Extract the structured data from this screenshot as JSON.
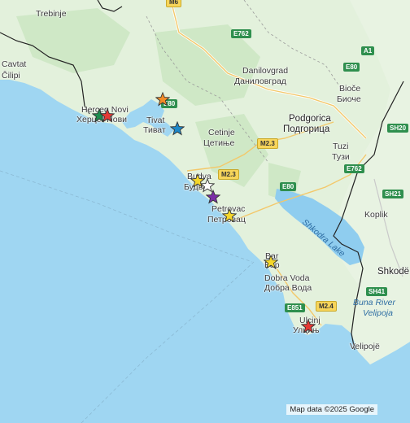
{
  "map": {
    "attribution": "Map data ©2025 Google",
    "colors": {
      "sea": "#9fd6f2",
      "land": "#dff0db",
      "forest": "#c8e6c0",
      "lake": "#8fcdef",
      "border": "#222222"
    }
  },
  "places": [
    {
      "id": "trebinje",
      "name": "Trebinje"
    },
    {
      "id": "cavtat",
      "name": "Cavtat"
    },
    {
      "id": "cilipi",
      "name": "Čilipi"
    },
    {
      "id": "herceg-lat",
      "name": "Herceg Novi"
    },
    {
      "id": "herceg-cyr",
      "name": "Херцег Нови"
    },
    {
      "id": "tivat-lat",
      "name": "Tivat"
    },
    {
      "id": "tivat-cyr",
      "name": "Тиват"
    },
    {
      "id": "danilovgrad-lat",
      "name": "Danilovgrad"
    },
    {
      "id": "danilovgrad-cyr",
      "name": "Даниловград"
    },
    {
      "id": "biocje-lat",
      "name": "Bioče"
    },
    {
      "id": "biocje-cyr",
      "name": "Биоче"
    },
    {
      "id": "podgorica-lat",
      "name": "Podgorica"
    },
    {
      "id": "podgorica-cyr",
      "name": "Подгорица"
    },
    {
      "id": "cetinje-lat",
      "name": "Cetinje"
    },
    {
      "id": "cetinje-cyr",
      "name": "Цетиње"
    },
    {
      "id": "tuzi-lat",
      "name": "Tuzi"
    },
    {
      "id": "tuzi-cyr",
      "name": "Тузи"
    },
    {
      "id": "budva-lat",
      "name": "Budva"
    },
    {
      "id": "budva-cyr",
      "name": "Будва"
    },
    {
      "id": "petrovac-lat",
      "name": "Petrovac"
    },
    {
      "id": "petrovac-cyr",
      "name": "Петровац"
    },
    {
      "id": "koplik",
      "name": "Koplik"
    },
    {
      "id": "bar-lat",
      "name": "Bar"
    },
    {
      "id": "bar-cyr",
      "name": "Бар"
    },
    {
      "id": "dobra-lat",
      "name": "Dobra Voda"
    },
    {
      "id": "dobra-cyr",
      "name": "Добра Вода"
    },
    {
      "id": "shkoder",
      "name": "Shkodë"
    },
    {
      "id": "ulcinj-lat",
      "name": "Ulcinj"
    },
    {
      "id": "ulcinj-cyr",
      "name": "Улцињ"
    },
    {
      "id": "velipoje",
      "name": "Velipojë"
    }
  ],
  "water_labels": [
    {
      "id": "skadar",
      "name": "Shkodra Lake"
    },
    {
      "id": "buna",
      "name": "Buna River"
    },
    {
      "id": "velipoja",
      "name": "Velipoja"
    }
  ],
  "road_shields": [
    {
      "id": "m6",
      "label": "M6",
      "style": "yellow"
    },
    {
      "id": "e762-n",
      "label": "E762",
      "style": "green"
    },
    {
      "id": "a1",
      "label": "A1",
      "style": "green"
    },
    {
      "id": "e80-n",
      "label": "E80",
      "style": "green"
    },
    {
      "id": "e80-w",
      "label": "E80",
      "style": "green"
    },
    {
      "id": "m23-a",
      "label": "M2.3",
      "style": "yellow"
    },
    {
      "id": "m23-b",
      "label": "M2.3",
      "style": "yellow"
    },
    {
      "id": "sh20",
      "label": "SH20",
      "style": "green"
    },
    {
      "id": "e762-s",
      "label": "E762",
      "style": "green"
    },
    {
      "id": "e80-s",
      "label": "E80",
      "style": "green"
    },
    {
      "id": "sh21",
      "label": "SH21",
      "style": "green"
    },
    {
      "id": "sh41",
      "label": "SH41",
      "style": "green"
    },
    {
      "id": "e851",
      "label": "E851",
      "style": "green"
    },
    {
      "id": "m24",
      "label": "M2.4",
      "style": "yellow"
    }
  ],
  "markers": [
    {
      "id": "kotor",
      "icon": "star-icon",
      "color": "#f28c28"
    },
    {
      "id": "herceg-green",
      "icon": "star-icon",
      "color": "#1e8c4e"
    },
    {
      "id": "herceg-red",
      "icon": "star-icon",
      "color": "#e53935"
    },
    {
      "id": "tivat-blue",
      "icon": "star-icon",
      "color": "#1e88c8"
    },
    {
      "id": "budva-yellow",
      "icon": "star-icon",
      "color": "#f5d72b"
    },
    {
      "id": "budva-white",
      "icon": "star-icon",
      "color": "#ffffff"
    },
    {
      "id": "budva-purple",
      "icon": "star-icon",
      "color": "#7b2fa6"
    },
    {
      "id": "petrovac-yellow",
      "icon": "star-icon",
      "color": "#f5d72b"
    },
    {
      "id": "bar-yellow",
      "icon": "star-icon",
      "color": "#f5d72b"
    },
    {
      "id": "ulcinj-red",
      "icon": "star-icon",
      "color": "#e53935"
    }
  ]
}
